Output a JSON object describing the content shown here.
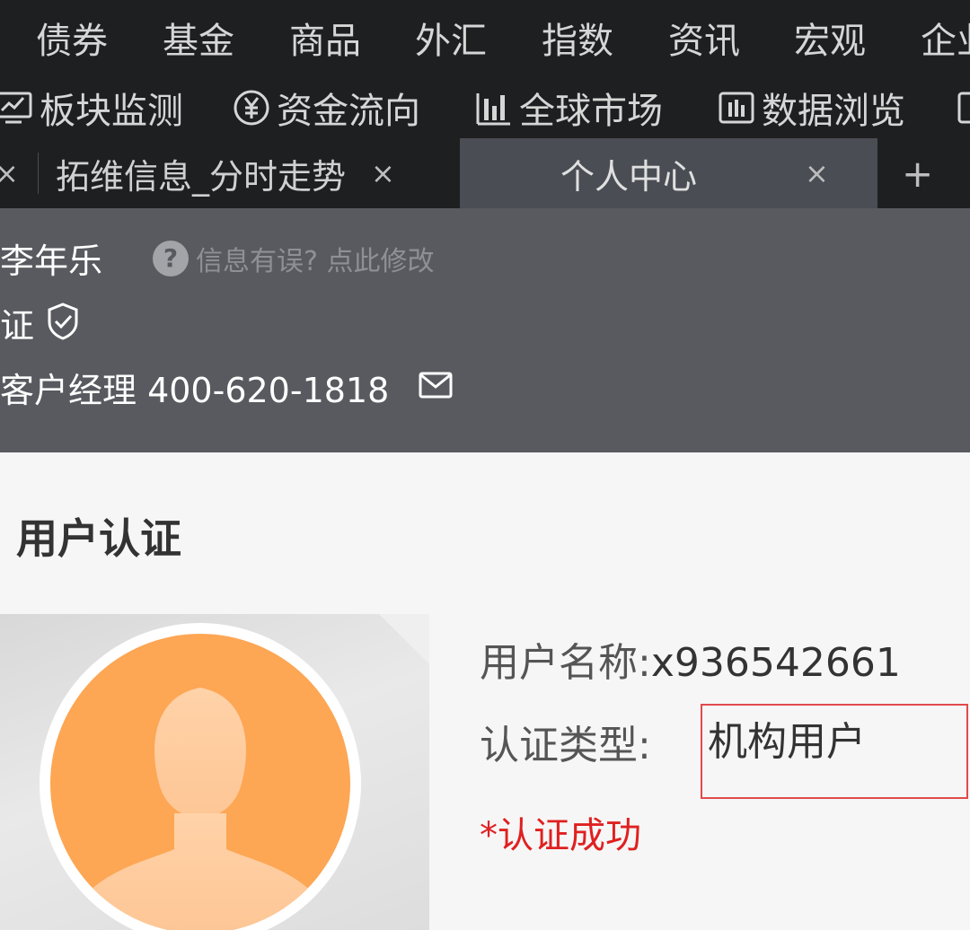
{
  "menu": {
    "items": [
      "债券",
      "基金",
      "商品",
      "外汇",
      "指数",
      "资讯",
      "宏观",
      "企业"
    ]
  },
  "toolbar": {
    "items": [
      {
        "label": "板块监测",
        "icon": "monitor-icon"
      },
      {
        "label": "资金流向",
        "icon": "yen-coin-icon"
      },
      {
        "label": "全球市场",
        "icon": "bar-chart-icon"
      },
      {
        "label": "数据浏览",
        "icon": "data-browse-icon"
      }
    ]
  },
  "tabs": {
    "items": [
      {
        "label": "拓维信息_分时走势",
        "close": "×",
        "active": false
      },
      {
        "label": "个人中心",
        "close": "×",
        "active": true
      }
    ],
    "add": "+",
    "left_close": "×"
  },
  "profile": {
    "name": "李年乐",
    "help_text": "信息有误? 点此修改",
    "help_icon": "?",
    "certified_text": "证",
    "manager_text": "客户经理 400-620-1818"
  },
  "auth": {
    "title": "用户认证",
    "username_label": "用户名称:",
    "username_value": "x936542661",
    "type_label": "认证类型:",
    "type_value": "机构用户",
    "status": "*认证成功"
  },
  "colors": {
    "menubar_bg": "#1e1f21",
    "profile_bg": "#595a5f",
    "active_tab_bg": "#4a4d54",
    "avatar_orange": "#fda654",
    "error_red": "#e02020"
  }
}
